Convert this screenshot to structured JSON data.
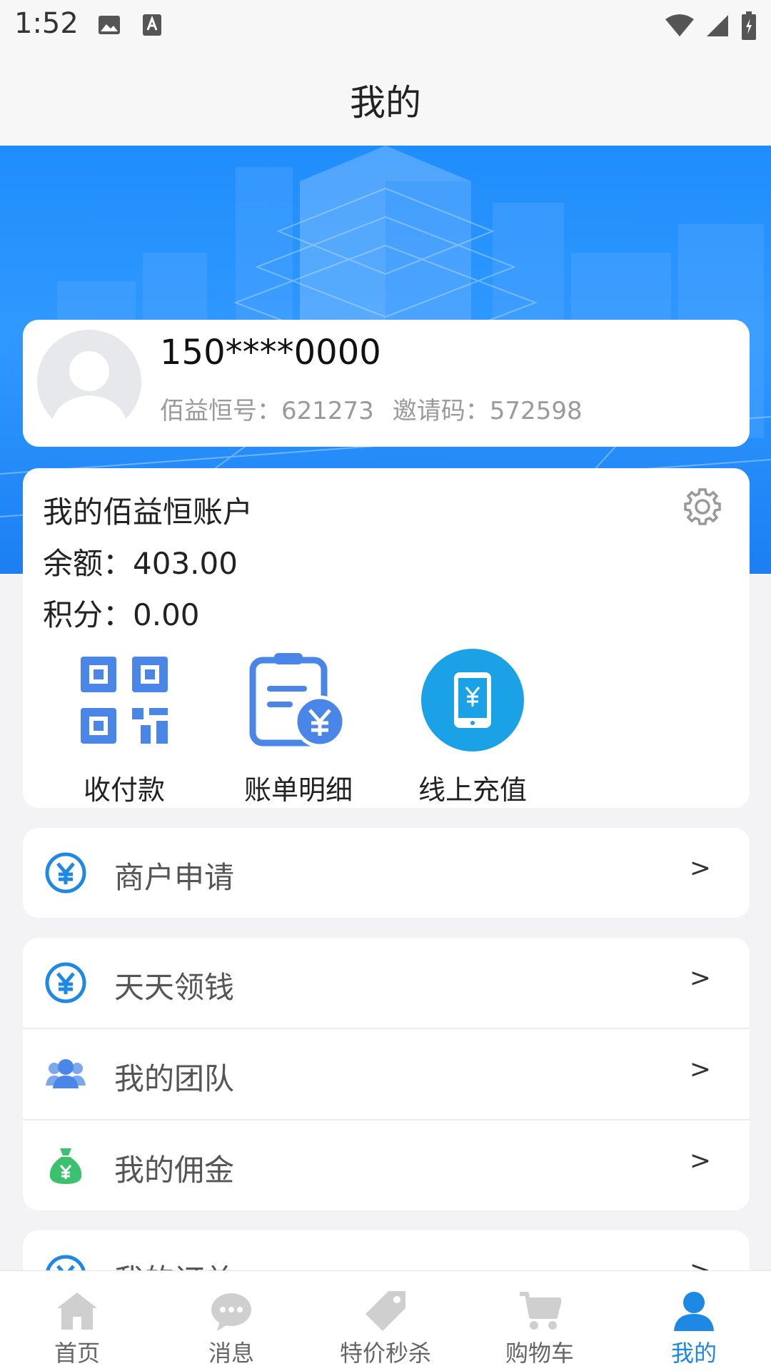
{
  "status_bar": {
    "time": "1:52"
  },
  "header": {
    "title": "我的"
  },
  "profile": {
    "phone": "150****0000",
    "account_label": "佰益恒号：621273",
    "invite_label": "邀请码：572598"
  },
  "account": {
    "title": "我的佰益恒账户",
    "balance": "余额：403.00",
    "points": "积分：0.00",
    "actions": [
      {
        "label": "收付款",
        "icon": "qr-code-icon"
      },
      {
        "label": "账单明细",
        "icon": "bill-detail-icon"
      },
      {
        "label": "线上充值",
        "icon": "mobile-recharge-icon"
      }
    ]
  },
  "menu": {
    "merchant": {
      "label": "商户申请",
      "arrow": ">"
    },
    "items": [
      {
        "label": "天天领钱",
        "arrow": ">",
        "icon": "yen-circle-icon"
      },
      {
        "label": "我的团队",
        "arrow": ">",
        "icon": "team-icon"
      },
      {
        "label": "我的佣金",
        "arrow": ">",
        "icon": "money-bag-icon"
      }
    ],
    "partial": {
      "label": "我的订单",
      "arrow": ">"
    }
  },
  "tabs": [
    {
      "label": "首页",
      "icon": "home-icon"
    },
    {
      "label": "消息",
      "icon": "message-icon"
    },
    {
      "label": "特价秒杀",
      "icon": "tag-icon"
    },
    {
      "label": "购物车",
      "icon": "cart-icon"
    },
    {
      "label": "我的",
      "icon": "user-icon"
    }
  ],
  "colors": {
    "brand_blue": "#1e88e5",
    "hero_blue": "#2f99ff",
    "icon_blue": "#4a86e8",
    "recharge_blue": "#1aa1e6",
    "commission_green": "#3cc26e"
  }
}
